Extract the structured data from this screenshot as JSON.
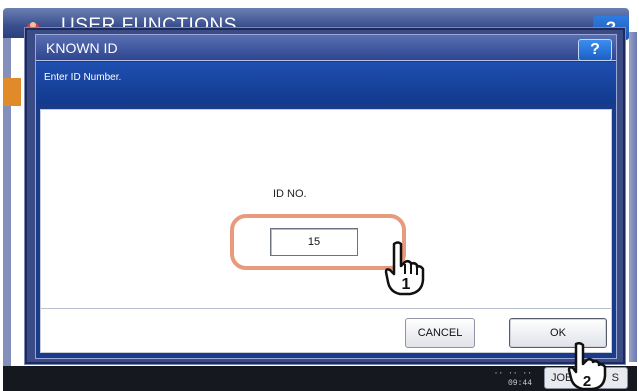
{
  "background": {
    "title": "USER FUNCTIONS",
    "help_label": "?",
    "date_line1": "",
    "time": "09:44",
    "job_button_label": "JOB",
    "job_button_suffix": "S"
  },
  "dialog": {
    "title": "KNOWN ID",
    "help_label": "?",
    "instruction": "Enter ID Number.",
    "field_label": "ID NO.",
    "field_value": "15",
    "cancel_label": "CANCEL",
    "ok_label": "OK"
  },
  "annotations": {
    "step1": "1",
    "step2": "2",
    "highlight_color": "#e79a7c"
  },
  "colors": {
    "header_blue": "#3a4f8e",
    "instruction_blue": "#1f4fb1",
    "help_button_blue": "#2f7ce0"
  }
}
